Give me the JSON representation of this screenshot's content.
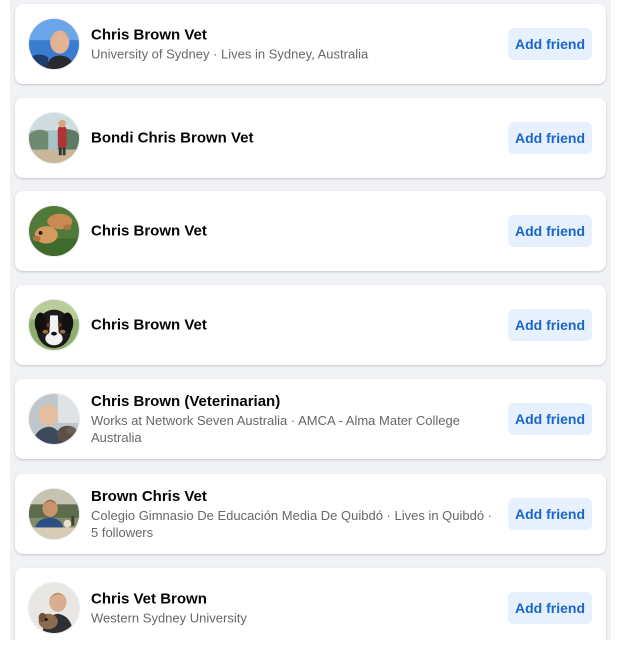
{
  "results": [
    {
      "name": "Chris Brown Vet",
      "meta": "University of Sydney · Lives in Sydney, Australia",
      "button": "Add friend",
      "avatar": "man-selfie-blue-sky"
    },
    {
      "name": "Bondi Chris Brown Vet",
      "meta": "",
      "button": "Add friend",
      "avatar": "person-at-beach-cliff"
    },
    {
      "name": "Chris Brown Vet",
      "meta": "",
      "button": "Add friend",
      "avatar": "golden-puppies-on-grass"
    },
    {
      "name": "Chris Brown Vet",
      "meta": "",
      "button": "Add friend",
      "avatar": "bernese-dog"
    },
    {
      "name": "Chris Brown (Veterinarian)",
      "meta": "Works at Network Seven Australia · AMCA - Alma Mater College Australia",
      "button": "Add friend",
      "avatar": "man-with-dog"
    },
    {
      "name": "Brown Chris Vet",
      "meta": "Colegio Gimnasio De Educación Media De Quibdó · Lives in Quibdó · 5 followers",
      "button": "Add friend",
      "avatar": "man-at-table-outdoors"
    },
    {
      "name": "Chris Vet Brown",
      "meta": "Western Sydney University",
      "button": "Add friend",
      "avatar": "man-holding-puppy"
    }
  ],
  "colors": {
    "feed_background": "#f0f2f5",
    "card_background": "#ffffff",
    "name_text": "#050505",
    "meta_text": "#65676b",
    "button_background": "#e7f0fd",
    "button_text": "#1a66c8"
  }
}
